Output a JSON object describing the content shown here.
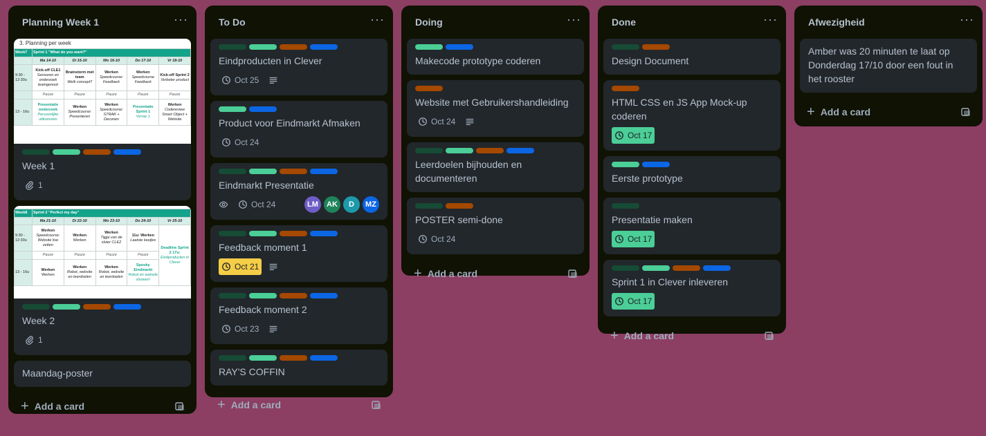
{
  "colors": {
    "label_darkgreen": "#164b35",
    "label_green": "#4bce97",
    "label_orange": "#a54800",
    "label_blue": "#0c66e4"
  },
  "lists": {
    "planning": {
      "title": "Planning Week 1",
      "card1": {
        "cover_title": "3. Planning per week",
        "week_label": "Week7",
        "sprint": "Sprint 1 \"What do you want?\"",
        "days": [
          "Ma 14-10",
          "Di 15-10",
          "Wo 16-10",
          "Do 17-10",
          "Vr 18-10"
        ],
        "time1": "9:30 - 12:30u",
        "row1": [
          [
            "Kick-off CLE1",
            "Sensoren en onderzoek teamgenoot"
          ],
          [
            "Brainstorm met team",
            "Welk concept?"
          ],
          [
            "Werken",
            "Speedcourse: Feedback"
          ],
          [
            "Werken",
            "Speedcourse Feedback"
          ],
          [
            "Kick-off Sprint 2",
            "Verbeter product"
          ]
        ],
        "pause": "Pauze",
        "time2": "13 - 16u",
        "row2": [
          [
            "Presentatie onderzoek",
            "Persoonlijke uitkomsten"
          ],
          [
            "Werken",
            "Speedcourse: Presenteren"
          ],
          [
            "Werken",
            "Speedcourse: STRAK + Deconen"
          ],
          [
            "Presentatie Sprint 1",
            "Versie 1"
          ],
          [
            "Werken",
            "Codereview Smart Object + Website"
          ]
        ],
        "title": "Week 1",
        "attachments": "1"
      },
      "card2": {
        "week_label": "Week8",
        "sprint": "Sprint 2 \"Perfect my day\"",
        "days": [
          "Ma 21-10",
          "Di 22-10",
          "Wo 23-10",
          "Do 24-10",
          "Vr 25-10"
        ],
        "time1": "9:30 - 12:30u",
        "row1": [
          [
            "Werken",
            "Speedcourse: Website live zetten"
          ],
          [
            "Werken",
            "Werken"
          ],
          [
            "Werken",
            "Tijgje van de sluier CLE2"
          ],
          [
            "11u: Werken",
            "Laatste loodjes"
          ]
        ],
        "deadline": [
          "Deadline Sprint 2 17u:",
          "Eindproducten in Clever"
        ],
        "pause": "Pauze",
        "time2": "13 - 16u",
        "row2": [
          [
            "Werken",
            "Werken"
          ],
          [
            "Werken",
            "Robot, website en leerdoelen"
          ],
          [
            "Werken",
            "Robot, website en leerdoelen"
          ],
          [
            "Spooky Eindmarkt",
            "Robot en website showen!"
          ]
        ],
        "title": "Week 2",
        "attachments": "1"
      },
      "card3": {
        "title": "Maandag-poster"
      },
      "add_card": "Add a card"
    },
    "todo": {
      "title": "To Do",
      "cards": [
        {
          "title": "Eindproducten in Clever",
          "due": "Oct 25"
        },
        {
          "title": "Product voor Eindmarkt Afmaken",
          "due": "Oct 24"
        },
        {
          "title": "Eindmarkt Presentatie",
          "due": "Oct 24",
          "members": [
            "LM",
            "AK",
            "D",
            "MZ"
          ]
        },
        {
          "title": "Feedback moment 1",
          "due": "Oct 21"
        },
        {
          "title": "Feedback moment 2",
          "due": "Oct 23"
        },
        {
          "title": "RAY'S COFFIN"
        }
      ],
      "add_card": "Add a card"
    },
    "doing": {
      "title": "Doing",
      "cards": [
        {
          "title": "Makecode prototype coderen"
        },
        {
          "title": "Website met Gebruikershandleiding",
          "due": "Oct 24"
        },
        {
          "title": "Leerdoelen bijhouden en documenteren"
        },
        {
          "title": "POSTER semi-done",
          "due": "Oct 24"
        }
      ],
      "add_card": "Add a card"
    },
    "done": {
      "title": "Done",
      "cards": [
        {
          "title": "Design Document"
        },
        {
          "title": "HTML CSS en JS App Mock-up coderen",
          "due": "Oct 17"
        },
        {
          "title": "Eerste prototype"
        },
        {
          "title": "Presentatie maken",
          "due": "Oct 17"
        },
        {
          "title": "Sprint 1 in Clever inleveren",
          "due": "Oct 17"
        }
      ],
      "add_card": "Add a card"
    },
    "absence": {
      "title": "Afwezigheid",
      "cards": [
        {
          "title": "Amber was 20 minuten te laat op Donderdag 17/10 door een fout in het rooster"
        }
      ],
      "add_card": "Add a card"
    }
  },
  "menu_glyph": "···"
}
